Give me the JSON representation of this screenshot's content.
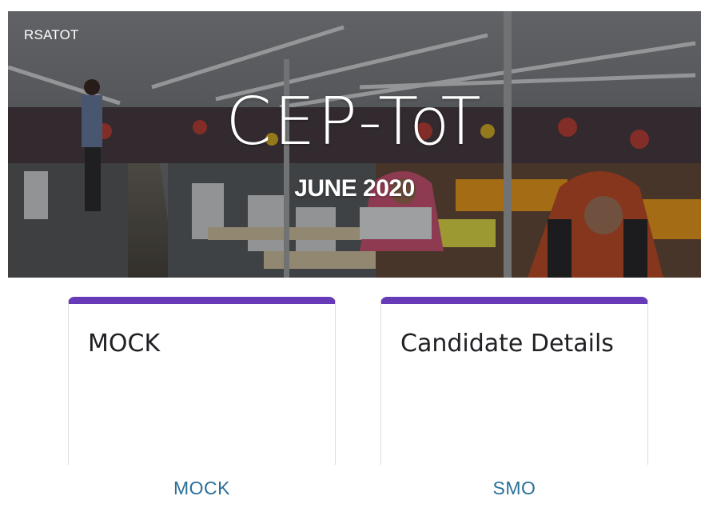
{
  "header": {
    "site_name": "RSATOT",
    "title": "CEP-ToT",
    "subtitle": "JUNE 2020"
  },
  "cards": [
    {
      "title": "MOCK",
      "link_label": "MOCK"
    },
    {
      "title": "Candidate Details",
      "link_label": "SMO"
    }
  ],
  "colors": {
    "card_accent": "#673ab7",
    "link": "#2a6f97"
  }
}
